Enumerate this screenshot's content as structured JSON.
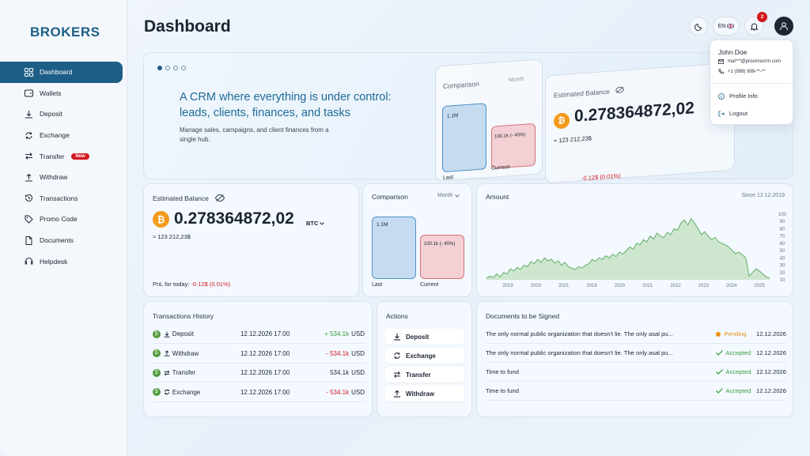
{
  "brand": "BROKERS",
  "page_title": "Dashboard",
  "sidebar": {
    "items": [
      {
        "label": "Dashboard",
        "icon": "grid-icon",
        "active": true
      },
      {
        "label": "Wallets",
        "icon": "wallet-icon"
      },
      {
        "label": "Deposit",
        "icon": "download-icon"
      },
      {
        "label": "Exchange",
        "icon": "exchange-icon"
      },
      {
        "label": "Transfer",
        "icon": "transfer-icon",
        "badge": "New"
      },
      {
        "label": "Withdraw",
        "icon": "upload-icon"
      },
      {
        "label": "Transactions",
        "icon": "history-icon"
      },
      {
        "label": "Promo Code",
        "icon": "tag-icon"
      },
      {
        "label": "Documents",
        "icon": "document-icon"
      },
      {
        "label": "Helpdesk",
        "icon": "headset-icon"
      }
    ]
  },
  "topbar": {
    "language": "EN",
    "notification_count": "2"
  },
  "user_menu": {
    "name": "John Doe",
    "email": "mai***@proximocrm.com",
    "phone": "+1 (999) 999-**-**",
    "items": [
      "Profile Info",
      "Logout"
    ]
  },
  "hero": {
    "heading": "A CRM where everything is under control: leads, clients, finances, and tasks",
    "description": "Manage sales, campaigns, and client finances from a single hub.",
    "preview_comparison_title": "Comparison",
    "preview_period": "Month",
    "preview_last_value": "1.1M",
    "preview_current_value": "100.1k (- 40%)",
    "preview_last_label": "Last",
    "preview_current_label": "Current",
    "preview_balance_title": "Estimated Balance",
    "preview_balance_value": "0.278364872,02",
    "preview_fiat": "≈ 123 212,23$",
    "preview_pnl": "-0.12$ (0.01%)"
  },
  "balance": {
    "title": "Estimated Balance",
    "value": "0.278364872,02",
    "currency": "BTC",
    "fiat": "≈ 123 212,23$",
    "pnl_label": "PnL for today:",
    "pnl_value": "-0.12$ (0.01%)"
  },
  "comparison": {
    "title": "Comparison",
    "period": "Month",
    "last_value": "1.1M",
    "current_value": "100.1k (- 40%)",
    "last_label": "Last",
    "current_label": "Current"
  },
  "amount": {
    "title": "Amount",
    "since": "Since 12.12.2019"
  },
  "chart_data": {
    "type": "area",
    "x_ticks": [
      "2019",
      "2020",
      "2021",
      "2019",
      "2020",
      "2021",
      "2022",
      "2023",
      "2024",
      "2025"
    ],
    "y_ticks": [
      10,
      20,
      30,
      40,
      50,
      60,
      70,
      80,
      90,
      100
    ],
    "ylim": [
      10,
      100
    ],
    "color": "#5fae67",
    "values": [
      12,
      15,
      13,
      18,
      14,
      20,
      18,
      25,
      22,
      27,
      24,
      30,
      28,
      35,
      32,
      38,
      34,
      40,
      36,
      38,
      33,
      36,
      30,
      34,
      28,
      26,
      24,
      28,
      26,
      30,
      32,
      38,
      35,
      40,
      38,
      43,
      40,
      45,
      42,
      48,
      45,
      50,
      55,
      52,
      60,
      58,
      65,
      62,
      70,
      66,
      74,
      70,
      68,
      75,
      72,
      80,
      78,
      88,
      92,
      85,
      94,
      88,
      80,
      72,
      76,
      70,
      65,
      68,
      62,
      60,
      58,
      55,
      50,
      46,
      48,
      44,
      40,
      15,
      20,
      25,
      22,
      18,
      14,
      12
    ]
  },
  "transactions": {
    "title": "Transactions History",
    "rows": [
      {
        "type": "Deposit",
        "icon": "download-icon",
        "date": "12.12.2026 17:00",
        "amount": "+ 534.1k",
        "currency": "USD",
        "tone": "green"
      },
      {
        "type": "Withdraw",
        "icon": "upload-icon",
        "date": "12.12.2026 17:00",
        "amount": "- 534.1k",
        "currency": "USD",
        "tone": "red"
      },
      {
        "type": "Transfer",
        "icon": "transfer-icon",
        "date": "12.12.2026 17:00",
        "amount": "534.1k",
        "currency": "USD",
        "tone": "neutral"
      },
      {
        "type": "Exchange",
        "icon": "exchange-icon",
        "date": "12.12.2026 17:00",
        "amount": "- 534.1k",
        "currency": "USD",
        "tone": "red"
      }
    ]
  },
  "actions": {
    "title": "Actions",
    "buttons": [
      "Deposit",
      "Exchange",
      "Transfer",
      "Withdraw"
    ]
  },
  "documents": {
    "title": "Documents to be Signed",
    "rows": [
      {
        "name": "The only normal public organization that doesn't lie. The only asal pu...",
        "status": "Pending",
        "date": "12.12.2026"
      },
      {
        "name": "The only normal public organization that doesn't lie. The only asal pu...",
        "status": "Accepted",
        "date": "12.12.2026"
      },
      {
        "name": "Time to fund",
        "status": "Accepted",
        "date": "12.12.2026"
      },
      {
        "name": "Time to fund",
        "status": "Accepted",
        "date": "12.12.2026"
      }
    ]
  },
  "colors": {
    "brand": "#1d5e86",
    "accent": "#1d6a96",
    "positive": "#3a9a3e",
    "negative": "#d3171e",
    "pending": "#e8901a",
    "bitcoin": "#f39a1c"
  }
}
